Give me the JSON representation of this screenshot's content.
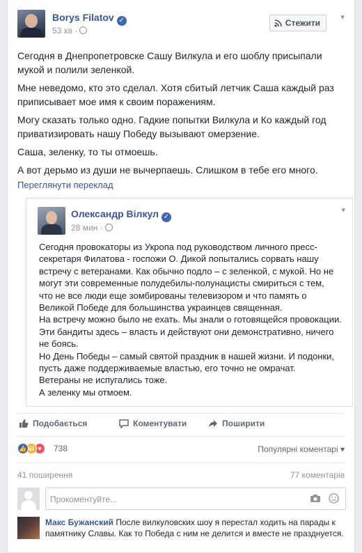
{
  "post": {
    "author": "Borys Filatov",
    "time": "53 хв",
    "follow_label": "Стежити",
    "paragraphs": [
      "Сегодня в Днепропетровске Сашу Вилкула и его шоблу присыпали мукой и полили зеленкой.",
      "Мне неведомо, кто это сделал. Хотя сбитый летчик Саша каждый раз приписывает мое имя к своим поражениям.",
      "Могу сказать только одно. Гадкие попытки Вилкула и Ко каждый год приватизировать нашу Победу вызывают омерзение.",
      "Саша, зеленку, то ты отмоешь.",
      "А вот дерьмо из души не вычерпаешь. Слишком в тебе его много."
    ],
    "translate_link": "Переглянути переклад"
  },
  "shared_post": {
    "author": "Олександр Вілкул",
    "time": "28 мин",
    "lines": [
      "Сегодня провокаторы из Укропа под руководством личного пресс-",
      "секретаря Филатова - госпожи О. Дикой попытались сорвать нашу",
      "встречу с ветеранами. Как обычно подло – с зеленкой, с мукой. Но не",
      "могут эти современные полудебилы-полунацисты смириться с тем,",
      "что не все люди еще зомбированы телевизором и что память о",
      "Великой Победе для большинства украинцев священная.",
      "На встречу можно было не ехать. Мы знали о готовящейся провокации.",
      "Эти бандиты здесь – власть и действуют они демонстративно, ничего",
      "не боясь.",
      "Но День Победы – самый святой праздник в нашей жизни. И подонки,",
      "пусть даже поддерживаемые властью, его точно не омрачат.",
      "Ветераны не испугались тоже.",
      "А зеленку мы отмоем."
    ]
  },
  "actions": {
    "like": "Подобається",
    "comment": "Коментувати",
    "share": "Поширити"
  },
  "stats": {
    "reaction_count": "738",
    "popular_comments": "Популярні коментарі",
    "shares": "41 поширення",
    "comments": "77 коментарів"
  },
  "comment_box": {
    "placeholder": "Прокоментуйте..."
  },
  "comment": {
    "author": "Макс Бужанский",
    "text": "После вилкуловских шоу я перестал ходить на парады к памятнику Славы. Как то Победа с ним не делится и вместе не празднуется."
  },
  "colors": {
    "link": "#365899",
    "like_blue": "#4267b2",
    "haha_yellow": "#f7b125",
    "love_red": "#f25268"
  }
}
